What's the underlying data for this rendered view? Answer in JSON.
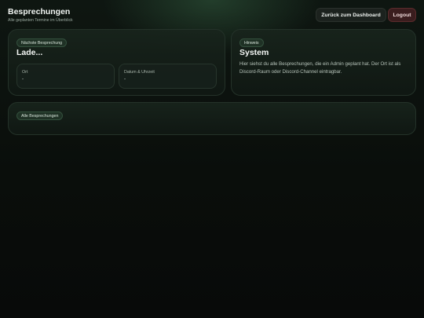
{
  "header": {
    "title": "Besprechungen",
    "subtitle": "Alle geplanten Termine im Überblick",
    "dashboard_button": "Zurück zum Dashboard",
    "logout_button": "Logout"
  },
  "next_meeting": {
    "chip": "Nächste Besprechung",
    "title": "Lade...",
    "location": {
      "label": "Ort",
      "value": "-"
    },
    "datetime": {
      "label": "Datum & Uhrzeit",
      "value": "-"
    }
  },
  "hint": {
    "chip": "Hinweis",
    "title": "System",
    "text": "Hier siehst du alle Besprechungen, die ein Admin geplant hat. Der Ort ist als Discord-Raum oder Discord-Channel eintragbar."
  },
  "all_meetings": {
    "chip": "Alle Besprechungen"
  },
  "colors": {
    "background": "#0a0e0b",
    "accent": "#33503d",
    "logout": "#3a1d1e"
  }
}
